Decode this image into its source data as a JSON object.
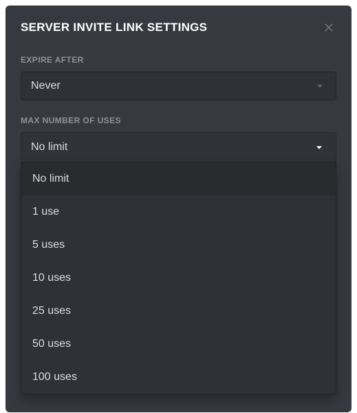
{
  "modal": {
    "title": "SERVER INVITE LINK SETTINGS"
  },
  "expire": {
    "label": "EXPIRE AFTER",
    "selected": "Never"
  },
  "uses": {
    "label": "MAX NUMBER OF USES",
    "selected": "No limit",
    "options": [
      "No limit",
      "1 use",
      "5 uses",
      "10 uses",
      "25 uses",
      "50 uses",
      "100 uses"
    ]
  }
}
